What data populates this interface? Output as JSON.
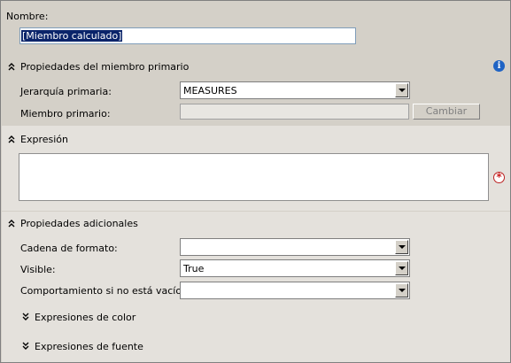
{
  "nombre": {
    "label": "Nombre:",
    "value": "[Miembro calculado]"
  },
  "parent_section": {
    "title": "Propiedades del miembro primario",
    "hierarchy_label": "Jerarquía primaria:",
    "hierarchy_value": "MEASURES",
    "member_label": "Miembro primario:",
    "member_value": "",
    "change_button": "Cambiar"
  },
  "expression_section": {
    "title": "Expresión",
    "value": ""
  },
  "additional_section": {
    "title": "Propiedades adicionales",
    "format_label": "Cadena de formato:",
    "format_value": "",
    "visible_label": "Visible:",
    "visible_value": "True",
    "nonempty_label": "Comportamiento si no está vacío:",
    "nonempty_value": "",
    "color_expressions": "Expresiones de color",
    "font_expressions": "Expresiones de fuente"
  },
  "icons": {
    "info": "info-icon",
    "required": "required-icon",
    "collapse": "double-chevron-up-icon",
    "expand": "double-chevron-down-icon"
  },
  "colors": {
    "panel": "#d4d0c8",
    "band": "#e4e1dc",
    "info_blue": "#1f63c4",
    "required_red": "#c22222"
  }
}
